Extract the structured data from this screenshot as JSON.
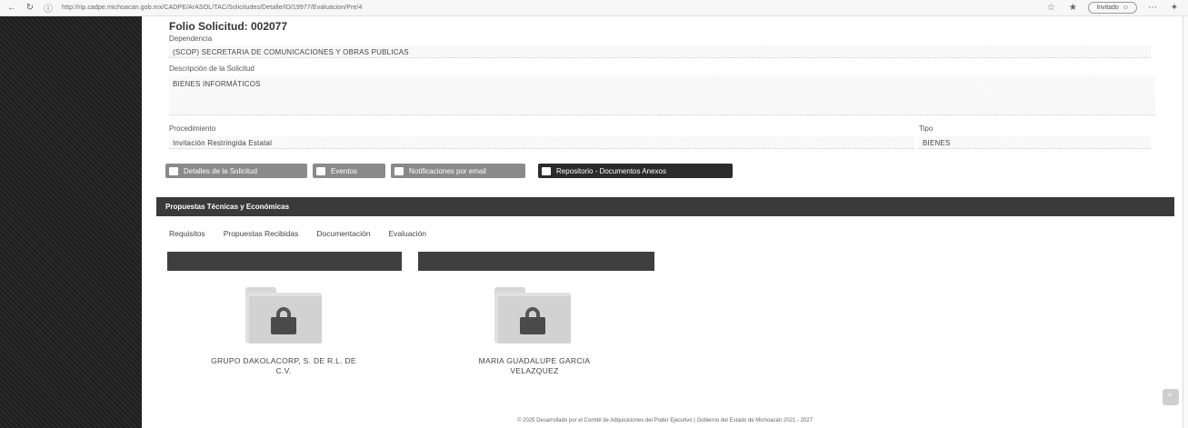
{
  "browser": {
    "url": "http://rip.cadpe.michoacan.gob.mx/CADPE/ArASOL/TAC/Solicitudes/Detalle/ID/19977/Evaluacion/Pre/4",
    "profile_label": "Invitado"
  },
  "header": {
    "folio": "Folio Solicitud: 002077"
  },
  "fields": {
    "dependencia_label": "Dependencia",
    "dependencia_value": "(SCOP) SECRETARIA DE COMUNICACIONES Y OBRAS PUBLICAS",
    "descripcion_label": "Descripción de la Solicitud",
    "descripcion_value": "BIENES INFORMÁTICOS",
    "procedimiento_label": "Procedimiento",
    "procedimiento_value": "Invitación Restringida Estatal",
    "tipo_label": "Tipo",
    "tipo_value": "BIENES"
  },
  "buttons": {
    "detalles": "Detalles de la Solicitud",
    "eventos": "Eventos",
    "notificaciones": "Notificaciones por email",
    "repositorio": "Repositorio - Documentos Anexos"
  },
  "section": {
    "title": "Propuestas Técnicas y Económicas"
  },
  "tabs": [
    {
      "label": "Requisitos"
    },
    {
      "label": "Propuestas Recibidas"
    },
    {
      "label": "Documentación"
    },
    {
      "label": "Evaluación"
    }
  ],
  "proposals": [
    {
      "name_line1": "GRUPO DAKOLACORP, S. DE R.L. DE",
      "name_line2": "C.V."
    },
    {
      "name_line1": "MARIA GUADALUPE GARCIA",
      "name_line2": "VELAZQUEZ"
    }
  ],
  "footer": {
    "text": "© 2025 Desarrollado por el Comité de Adquisiciones del Poder Ejecutivo | Gobierno del Estado de Michoacán 2021 - 2027"
  },
  "colors": {
    "sidebar": "#222222",
    "section_bar": "#3a3a3a",
    "button_grey": "#8a8a8a",
    "button_dark": "#2b2b2b"
  }
}
